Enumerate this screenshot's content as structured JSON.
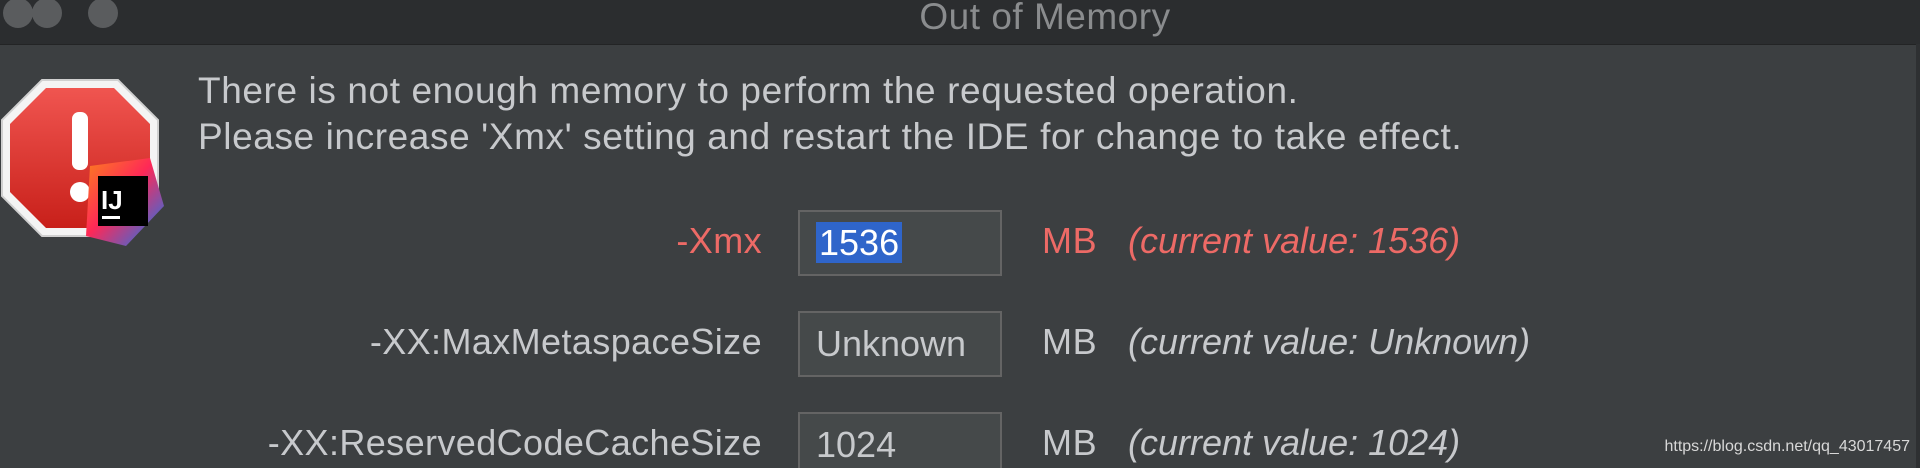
{
  "window": {
    "title": "Out of Memory"
  },
  "message": {
    "line1": "There is not enough memory to perform the requested operation.",
    "line2": "Please increase 'Xmx' setting and restart the IDE for change to take effect."
  },
  "icon": {
    "warning": "stop-warning-icon",
    "app_badge_text": "IJ"
  },
  "settings": [
    {
      "label": "-Xmx",
      "value": "1536",
      "unit": "MB",
      "current": "(current value: 1536)",
      "error": true
    },
    {
      "label": "-XX:MaxMetaspaceSize",
      "value": "Unknown",
      "unit": "MB",
      "current": "(current value: Unknown)",
      "error": false
    },
    {
      "label": "-XX:ReservedCodeCacheSize",
      "value": "1024",
      "unit": "MB",
      "current": "(current value: 1024)",
      "error": false
    }
  ],
  "colors": {
    "background": "#3c3f41",
    "text": "#c7c9cc",
    "error": "#ed6a66",
    "selection": "#2f65ca"
  },
  "watermark": "https://blog.csdn.net/qq_43017457"
}
